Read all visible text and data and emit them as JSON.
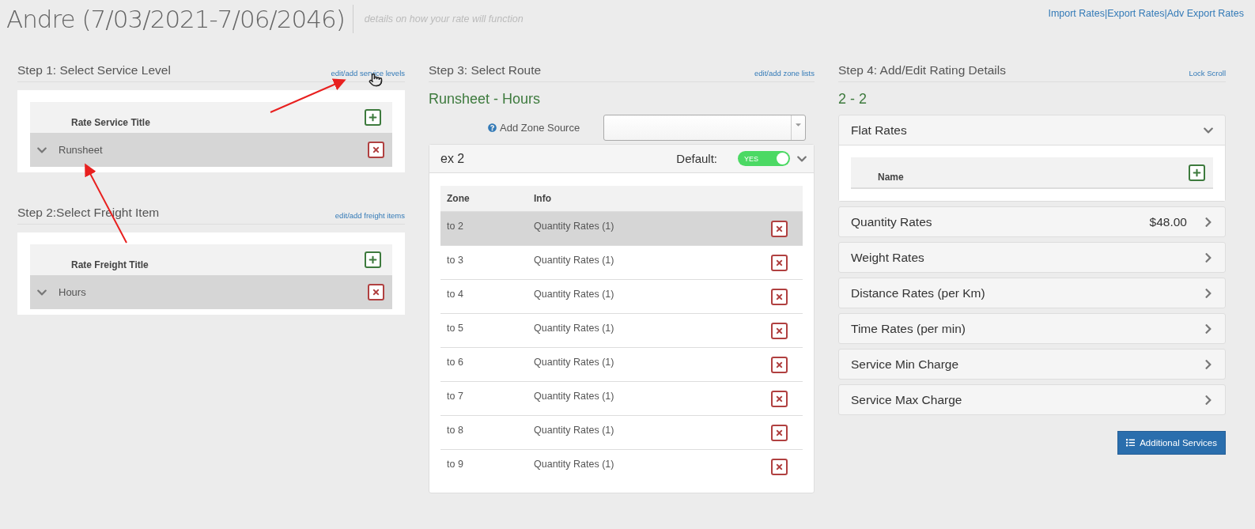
{
  "header": {
    "title": "Andre (7/03/2021-7/06/2046)",
    "subtitle": "details on how your rate will function",
    "links": [
      "Import Rates",
      "Export Rates",
      "Adv Export Rates"
    ],
    "separator": "|"
  },
  "step1": {
    "title": "Step 1: Select Service Level",
    "link": "edit/add service levels",
    "column": "Rate Service Title",
    "rows": [
      {
        "label": "Runsheet",
        "selected": true
      }
    ]
  },
  "step2": {
    "title": "Step 2:Select Freight Item",
    "link": "edit/add freight items",
    "column": "Rate Freight Title",
    "rows": [
      {
        "label": "Hours",
        "selected": true
      }
    ]
  },
  "step3": {
    "title": "Step 3: Select Route",
    "link": "edit/add zone lists",
    "route": "Runsheet - Hours",
    "zone_source_label": "Add Zone Source",
    "zone_group": {
      "name": "ex 2",
      "default_label": "Default:",
      "toggle_label": "YES",
      "on": true,
      "expanded": true
    },
    "columns": [
      "Zone",
      "Info"
    ],
    "rows": [
      {
        "zone": "to 2",
        "info": "Quantity Rates (1)",
        "selected": true
      },
      {
        "zone": "to 3",
        "info": "Quantity Rates (1)",
        "selected": false
      },
      {
        "zone": "to 4",
        "info": "Quantity Rates (1)",
        "selected": false
      },
      {
        "zone": "to 5",
        "info": "Quantity Rates (1)",
        "selected": false
      },
      {
        "zone": "to 6",
        "info": "Quantity Rates (1)",
        "selected": false
      },
      {
        "zone": "to 7",
        "info": "Quantity Rates (1)",
        "selected": false
      },
      {
        "zone": "to 8",
        "info": "Quantity Rates (1)",
        "selected": false
      },
      {
        "zone": "to 9",
        "info": "Quantity Rates (1)",
        "selected": false
      }
    ]
  },
  "step4": {
    "title": "Step 4: Add/Edit Rating Details",
    "link": "Lock Scroll",
    "zone": "2 - 2",
    "sections": [
      {
        "title": "Flat Rates",
        "expanded": true,
        "column": "Name"
      },
      {
        "title": "Quantity Rates",
        "expanded": false,
        "amount": "$48.00"
      },
      {
        "title": "Weight Rates",
        "expanded": false
      },
      {
        "title": "Distance Rates (per Km)",
        "expanded": false
      },
      {
        "title": "Time Rates (per min)",
        "expanded": false
      },
      {
        "title": "Service Min Charge",
        "expanded": false
      },
      {
        "title": "Service Max Charge",
        "expanded": false
      }
    ],
    "button": "Additional Services"
  }
}
